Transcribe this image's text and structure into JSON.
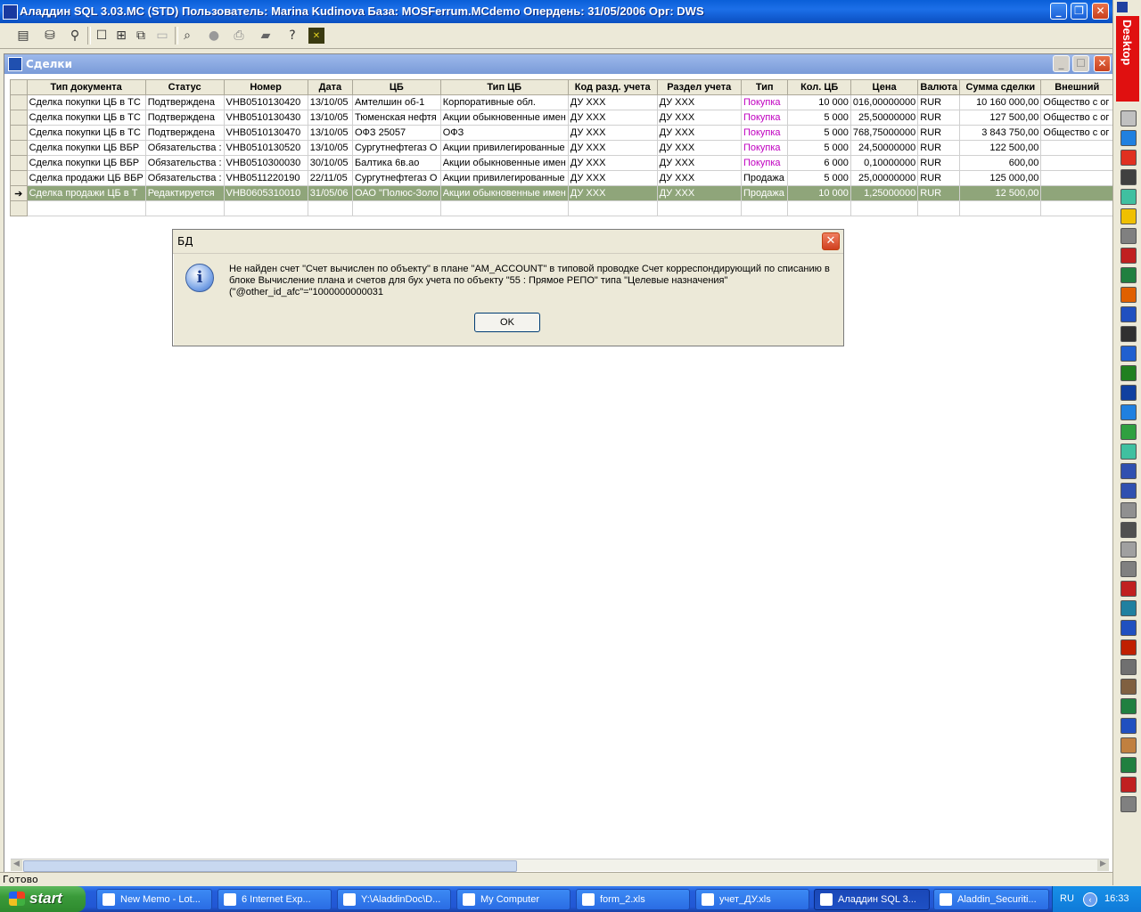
{
  "window": {
    "title": "Аладдин SQL 3.03.MC (STD)  Пользователь: Marina Kudinova База: MOSFerrum.MCdemo Опердень: 31/05/2006 Орг: DWS"
  },
  "child": {
    "title": "Сделки"
  },
  "grid": {
    "columns": [
      "Тип документа",
      "Статус",
      "Номер",
      "Дата",
      "ЦБ",
      "Тип ЦБ",
      "Код разд. учета",
      "Раздел учета",
      "Тип",
      "Кол. ЦБ",
      "Цена",
      "Валюта",
      "Сумма сделки",
      "Внешний"
    ],
    "rows": [
      [
        "Сделка покупки ЦБ в ТС",
        "Подтверждена",
        "VHB0510130420",
        "13/10/05",
        "Амтелшин об-1",
        "Корпоративные обл.",
        "ДУ ХХХ",
        "ДУ ХХХ",
        "Покупка",
        "10 000",
        "016,00000000",
        "RUR",
        "10 160 000,00",
        "Общество с ог"
      ],
      [
        "Сделка покупки ЦБ в ТС",
        "Подтверждена",
        "VHB0510130430",
        "13/10/05",
        "Тюменская нефтя",
        "Акции обыкновенные имен",
        "ДУ ХХХ",
        "ДУ ХХХ",
        "Покупка",
        "5 000",
        "25,50000000",
        "RUR",
        "127 500,00",
        "Общество с ог"
      ],
      [
        "Сделка покупки ЦБ в ТС",
        "Подтверждена",
        "VHB0510130470",
        "13/10/05",
        "ОФЗ 25057",
        "ОФЗ",
        "ДУ ХХХ",
        "ДУ ХХХ",
        "Покупка",
        "5 000",
        "768,75000000",
        "RUR",
        "3 843 750,00",
        "Общество с ог"
      ],
      [
        "Сделка покупки ЦБ ВБР",
        "Обязательства :",
        "VHB0510130520",
        "13/10/05",
        "Сургутнефтегаз О",
        "Акции привилегированные",
        "ДУ ХХХ",
        "ДУ ХХХ",
        "Покупка",
        "5 000",
        "24,50000000",
        "RUR",
        "122 500,00",
        ""
      ],
      [
        "Сделка покупки ЦБ ВБР",
        "Обязательства :",
        "VHB0510300030",
        "30/10/05",
        "Балтика 6в.ао",
        "Акции обыкновенные имен",
        "ДУ ХХХ",
        "ДУ ХХХ",
        "Покупка",
        "6 000",
        "0,10000000",
        "RUR",
        "600,00",
        ""
      ],
      [
        "Сделка продажи ЦБ ВБР",
        "Обязательства :",
        "VHB0511220190",
        "22/11/05",
        "Сургутнефтегаз О",
        "Акции привилегированные",
        "ДУ ХХХ",
        "ДУ ХХХ",
        "Продажа",
        "5 000",
        "25,00000000",
        "RUR",
        "125 000,00",
        ""
      ],
      [
        "Сделка продажи ЦБ в Т",
        "Редактируется",
        "VHB0605310010",
        "31/05/06",
        "ОАО \"Полюс-Золо",
        "Акции обыкновенные имен",
        "ДУ ХХХ",
        "ДУ ХХХ",
        "Продажа",
        "10 000",
        "1,25000000",
        "RUR",
        "12 500,00",
        ""
      ]
    ],
    "selected_row": 6,
    "row_indicator": "➔"
  },
  "dialog": {
    "title": "БД",
    "message": "Не найден счет \"Счет вычислен по объекту\" в плане \"AM_ACCOUNT\" в типовой  проводке Счет корреспондирующий по списанию в блоке Вычисление плана и  счетов для бух учета по объекту \"55 : Прямое РЕПО\" типа \"Целевые назначения\" (\"@other_id_afc\"=\"1000000000031",
    "ok_label": "OK"
  },
  "status": {
    "text": "Готово"
  },
  "desktop_strip": {
    "label": "Desktop"
  },
  "taskbar": {
    "start": "start",
    "tasks": [
      {
        "label": "New Memo - Lot..."
      },
      {
        "label": "6 Internet Exp..."
      },
      {
        "label": "Y:\\AladdinDoc\\D..."
      },
      {
        "label": "My Computer"
      },
      {
        "label": "form_2.xls"
      },
      {
        "label": "учет_ДУ.xls"
      },
      {
        "label": "Аладдин SQL 3..."
      },
      {
        "label": "Aladdin_Securiti..."
      }
    ],
    "lang": "RU",
    "clock": "16:33"
  },
  "colors": {
    "selected_row": "#8fa57a",
    "purchase_text": "#c000c0",
    "desktop_strip": "#e01010"
  }
}
